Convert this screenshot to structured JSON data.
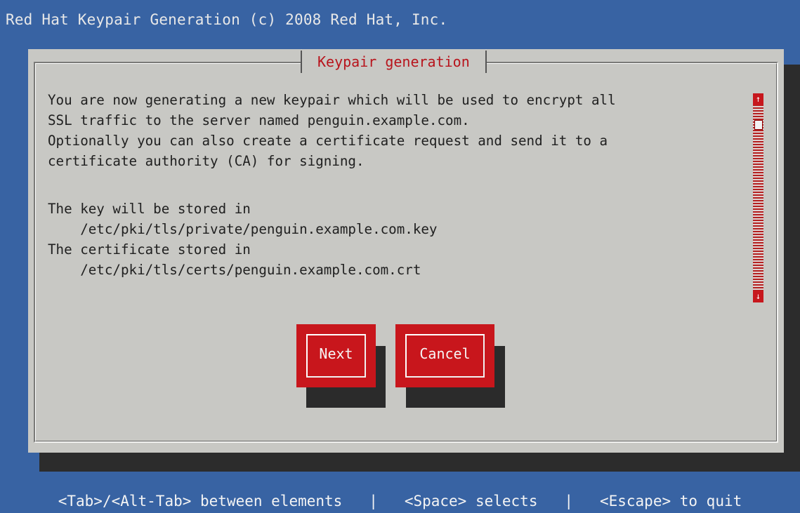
{
  "header": {
    "title": "Red Hat Keypair Generation (c) 2008 Red Hat, Inc."
  },
  "dialog": {
    "title": "Keypair generation",
    "body_lines": [
      "You are now generating a new keypair which will be used to encrypt all",
      "SSL traffic to the server named penguin.example.com.",
      "Optionally you can also create a certificate request and send it to a",
      "certificate authority (CA) for signing.",
      "",
      "The key will be stored in",
      "    /etc/pki/tls/private/penguin.example.com.key",
      "The certificate stored in",
      "    /etc/pki/tls/certs/penguin.example.com.crt"
    ],
    "buttons": {
      "next": "Next",
      "cancel": "Cancel"
    },
    "scrollbar": {
      "up_arrow": "↑",
      "down_arrow": "↓"
    }
  },
  "footer": {
    "help": "<Tab>/<Alt-Tab> between elements   |   <Space> selects   |   <Escape> to quit"
  },
  "colors": {
    "background": "#3863a3",
    "dialog": "#c8c8c4",
    "accent": "#c8161c",
    "text": "#202020"
  },
  "icons": {
    "scroll_up": "up-arrow-icon",
    "scroll_down": "down-arrow-icon"
  }
}
